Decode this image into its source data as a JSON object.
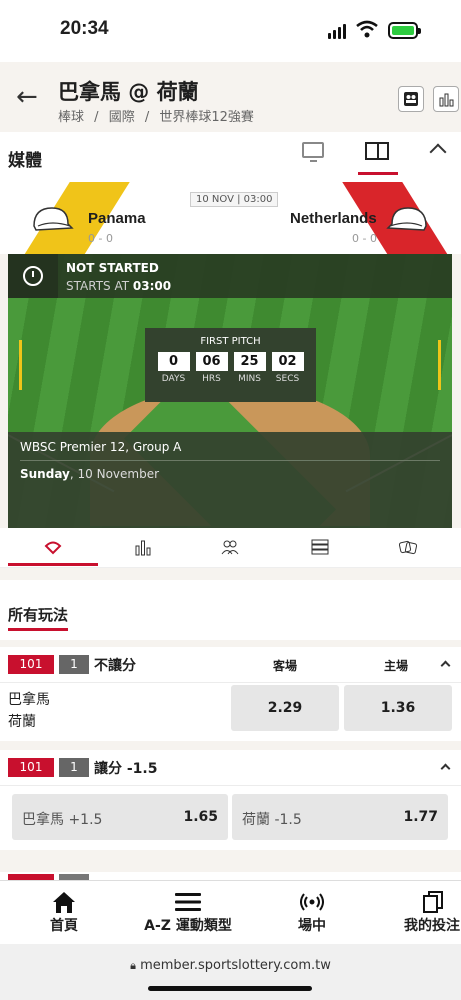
{
  "status_bar": {
    "time": "20:34"
  },
  "header": {
    "title": "巴拿馬 @ 荷蘭",
    "breadcrumb": [
      "棒球",
      "國際",
      "世界棒球12強賽"
    ],
    "breadcrumb_sep": "/"
  },
  "media": {
    "label": "媒體"
  },
  "match": {
    "date": "10 NOV | 03:00",
    "away": {
      "name": "Panama",
      "record": "0 - 0",
      "color": "#f0c419"
    },
    "home": {
      "name": "Netherlands",
      "record": "0 - 0",
      "color": "#d9252a"
    },
    "status": "NOT STARTED",
    "starts_at_label": "STARTS AT",
    "starts_at_time": "03:00",
    "first_pitch": {
      "title": "FIRST PITCH",
      "units": [
        {
          "value": "0",
          "label": "DAYS"
        },
        {
          "value": "06",
          "label": "HRS"
        },
        {
          "value": "25",
          "label": "MINS"
        },
        {
          "value": "02",
          "label": "SECS"
        }
      ]
    },
    "event_name": "WBSC Premier 12, Group A",
    "event_day": "Sunday",
    "event_date": ", 10 November"
  },
  "tabs": [
    "field-icon",
    "stats-icon",
    "lineup-icon",
    "table-icon",
    "dice-icon"
  ],
  "all_plays": {
    "label": "所有玩法"
  },
  "markets": [
    {
      "code": "101",
      "num": "1",
      "name": "不讓分",
      "away_col": "客場",
      "home_col": "主場",
      "teams": [
        "巴拿馬",
        "荷蘭"
      ],
      "odds": [
        "2.29",
        "1.36"
      ]
    },
    {
      "code": "101",
      "num": "1",
      "name": "讓分 -1.5",
      "options": [
        {
          "sel": "巴拿馬 +1.5",
          "odd": "1.65"
        },
        {
          "sel": "荷蘭 -1.5",
          "odd": "1.77"
        }
      ]
    }
  ],
  "bottom_nav": [
    {
      "label": "首頁",
      "icon": "home-icon"
    },
    {
      "label": "A-Z 運動類型",
      "icon": "menu-icon"
    },
    {
      "label": "場中",
      "icon": "live-icon"
    },
    {
      "label": "我的投注",
      "icon": "betslip-icon"
    }
  ],
  "url": "member.sportslottery.com.tw",
  "accent": "#c8102e"
}
